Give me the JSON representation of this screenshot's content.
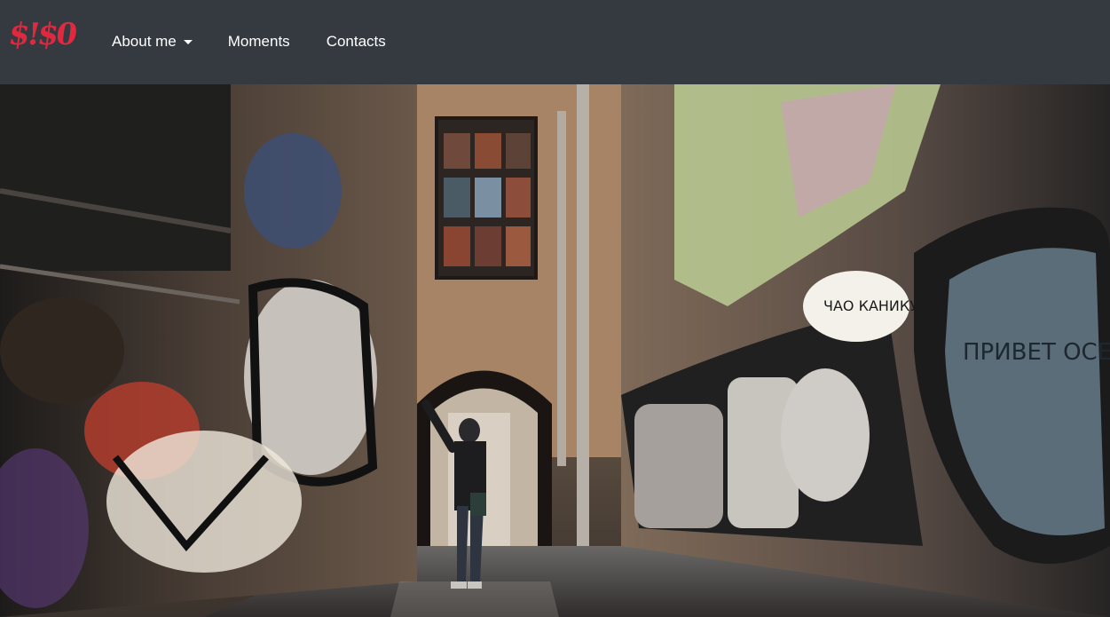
{
  "brand": {
    "text": "$!$0",
    "color": "#e0293f"
  },
  "nav": {
    "items": [
      {
        "label": "About me",
        "has_dropdown": true
      },
      {
        "label": "Moments"
      },
      {
        "label": "Contacts"
      }
    ]
  },
  "hero": {
    "image_subject": "graffiti alley with person in hoodie",
    "wall_text_1": "ПРИВЕТ ОСЕНЬ!",
    "wall_text_2": "ЧАО КАНИКУЛЫ!"
  },
  "colors": {
    "navbar_bg": "#343a40",
    "nav_text": "#ffffff"
  }
}
